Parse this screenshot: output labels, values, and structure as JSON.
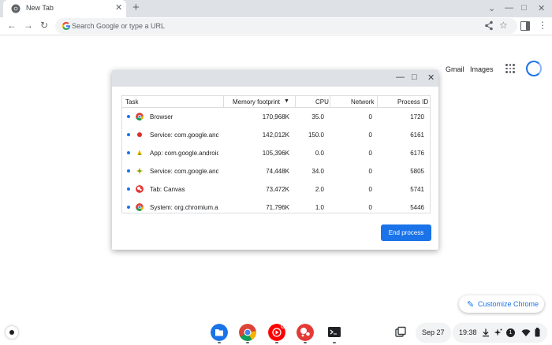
{
  "tab": {
    "title": "New Tab",
    "close": "✕",
    "new_tab": "+"
  },
  "window_controls": {
    "dropdown": "⌄",
    "minimize": "—",
    "maximize": "□",
    "close": "✕"
  },
  "toolbar": {
    "back": "←",
    "forward": "→",
    "reload": "↻",
    "placeholder": "Search Google or type a URL",
    "bookmark": "☆",
    "menu": "⋮"
  },
  "ntp": {
    "gmail": "Gmail",
    "images": "Images"
  },
  "task_manager": {
    "controls": {
      "minimize": "—",
      "maximize": "□",
      "close": "✕"
    },
    "columns": {
      "task": "Task",
      "memory": "Memory footprint",
      "sort_arrow": "▼",
      "cpu": "CPU",
      "network": "Network",
      "pid": "Process ID"
    },
    "rows": [
      {
        "name": "Browser",
        "memory": "170,968K",
        "cpu": "35.0",
        "network": "0",
        "pid": "1720",
        "icon": "chrome-icon"
      },
      {
        "name": "Service: com.google.android",
        "memory": "142,012K",
        "cpu": "150.0",
        "network": "0",
        "pid": "6161",
        "icon": "red-dot-icon"
      },
      {
        "name": "App: com.google.android",
        "memory": "105,396K",
        "cpu": "0.0",
        "network": "0",
        "pid": "6176",
        "icon": "android-app-icon"
      },
      {
        "name": "Service: com.google.android",
        "memory": "74,448K",
        "cpu": "34.0",
        "network": "0",
        "pid": "5805",
        "icon": "star-service-icon"
      },
      {
        "name": "Tab: Canvas",
        "memory": "73,472K",
        "cpu": "2.0",
        "network": "0",
        "pid": "5741",
        "icon": "canvas-icon"
      },
      {
        "name": "System: org.chromium.arc",
        "memory": "71,796K",
        "cpu": "1.0",
        "network": "0",
        "pid": "5446",
        "icon": "chrome-icon"
      }
    ],
    "end_process": "End process"
  },
  "customize": {
    "label": "Customize Chrome",
    "pen": "✎"
  },
  "shelf": {
    "apps": [
      "files-icon",
      "chrome-icon",
      "youtube-music-icon",
      "canvas-icon",
      "terminal-icon"
    ]
  },
  "tray": {
    "date": "Sep 27",
    "time": "19:38",
    "notification_count": "1"
  },
  "colors": {
    "accent": "#1a73e8",
    "titlebar": "#dee1e6",
    "omnibox": "#f1f3f4"
  }
}
